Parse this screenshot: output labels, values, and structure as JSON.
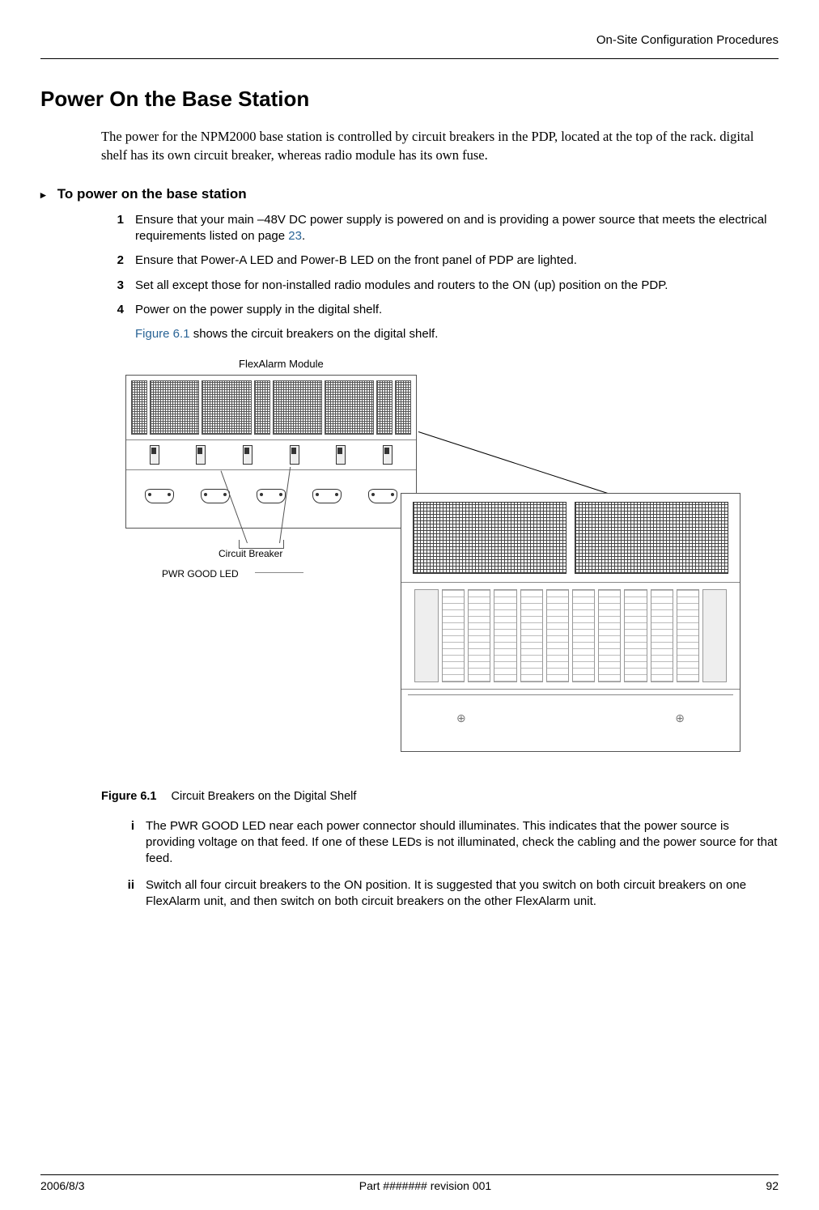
{
  "header": {
    "right": "On-Site Configuration Procedures"
  },
  "title": "Power On the Base Station",
  "intro": "The power for the NPM2000 base station is controlled by circuit breakers in the PDP, located at the top of the rack. digital shelf has its own circuit breaker, whereas radio module has its own fuse.",
  "procHeading": "To power on the base station",
  "steps": [
    {
      "n": "1",
      "text_pre": "Ensure that your main –48V DC power supply is powered on and is providing a power source that meets the electrical requirements listed on page ",
      "page_ref": "23",
      "text_post": "."
    },
    {
      "n": "2",
      "text": "Ensure that Power-A LED and Power-B LED on the front panel of PDP are lighted."
    },
    {
      "n": "3",
      "text": "Set all except those for non-installed radio modules and routers  to the ON (up) position on the PDP."
    },
    {
      "n": "4",
      "text": "Power on the power supply in the digital shelf."
    }
  ],
  "step4_extra": {
    "fig_ref": "Figure 6.1",
    "rest": " shows the circuit breakers on the digital shelf."
  },
  "figure": {
    "module_label": "FlexAlarm Module",
    "circuit_breaker_label": "Circuit Breaker",
    "pwr_good_label": "PWR GOOD LED",
    "caption_num": "Figure 6.1",
    "caption_text": "Circuit Breakers on the Digital Shelf"
  },
  "substeps": [
    {
      "n": "i",
      "text": "The PWR GOOD LED near each power connector should illuminates. This indicates that the power source is providing voltage on that feed. If one of these LEDs is not illuminated, check the cabling and the power source for that feed."
    },
    {
      "n": "ii",
      "text": "Switch all four circuit breakers to the ON position. It is suggested that you switch on both circuit breakers on one FlexAlarm unit, and then switch on both circuit breakers on the other FlexAlarm unit."
    }
  ],
  "footer": {
    "left": "2006/8/3",
    "center": "Part ####### revision 001",
    "right": "92"
  }
}
